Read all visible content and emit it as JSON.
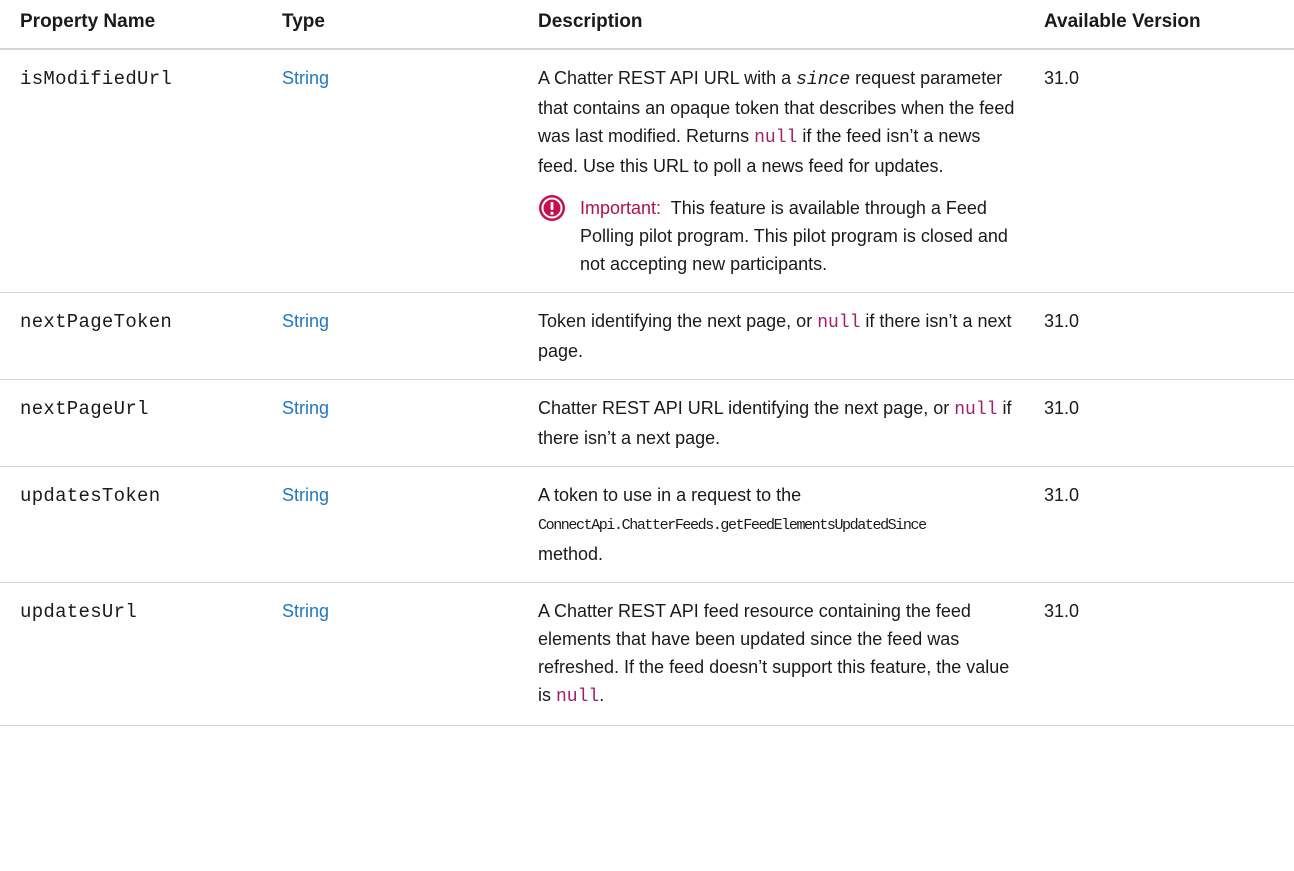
{
  "headers": {
    "property_name": "Property Name",
    "type": "Type",
    "description": "Description",
    "available_version": "Available Version"
  },
  "rows": [
    {
      "name": "isModifiedUrl",
      "type": "String",
      "version": "31.0",
      "desc": {
        "p1": "A Chatter REST API URL with a ",
        "p2": "since",
        "p3": " request parameter that contains an opaque token that describes when the feed was last modified. Returns ",
        "p4": "null",
        "p5": " if the feed isn’t a news feed. Use this URL to poll a news feed for updates."
      },
      "note": {
        "icon": "important-icon",
        "title": "Important:",
        "text": "This feature is available through a Feed Polling pilot program. This pilot program is closed and not accepting new participants."
      }
    },
    {
      "name": "nextPageToken",
      "type": "String",
      "version": "31.0",
      "desc": {
        "p1": "Token identifying the next page, or ",
        "p2": "null",
        "p3": " if there isn’t a next page."
      }
    },
    {
      "name": "nextPageUrl",
      "type": "String",
      "version": "31.0",
      "desc": {
        "p1": "Chatter REST API URL identifying the next page, or ",
        "p2": "null",
        "p3": " if there isn’t a next page."
      }
    },
    {
      "name": "updatesToken",
      "type": "String",
      "version": "31.0",
      "desc": {
        "p1": "A token to use in a request to the ",
        "p2": "ConnectApi.ChatterFeeds.getFeedElementsUpdatedSince",
        "p3": " method."
      }
    },
    {
      "name": "updatesUrl",
      "type": "String",
      "version": "31.0",
      "desc": {
        "p1": "A Chatter REST API feed resource containing the feed elements that have been updated since the feed was refreshed. If the feed doesn’t support this feature, the value is ",
        "p2": "null",
        "p3": "."
      }
    }
  ],
  "colors": {
    "link": "#1f78c4",
    "code": "#a0206a",
    "important": "#b0114a"
  }
}
